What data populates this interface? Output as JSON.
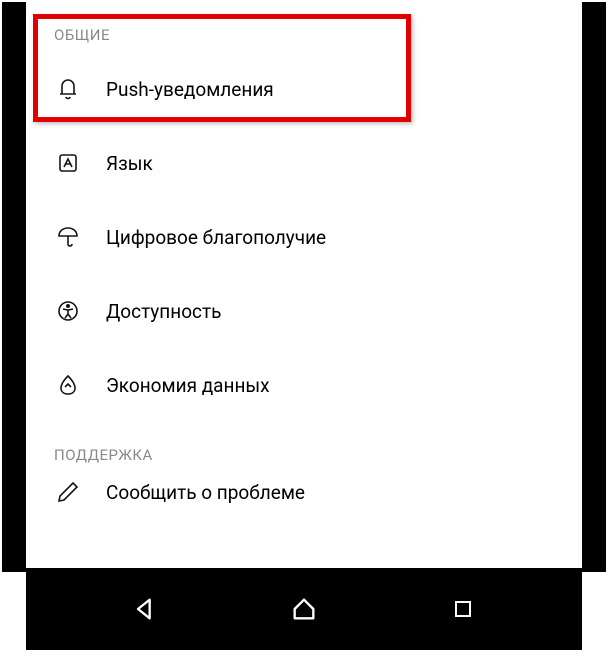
{
  "sections": {
    "general": {
      "header": "ОБЩИЕ",
      "items": [
        {
          "label": "Push-уведомления"
        },
        {
          "label": "Язык"
        },
        {
          "label": "Цифровое благополучие"
        },
        {
          "label": "Доступность"
        },
        {
          "label": "Экономия данных"
        }
      ]
    },
    "support": {
      "header": "ПОДДЕРЖКА",
      "items": [
        {
          "label": "Сообщить о проблеме"
        }
      ]
    }
  }
}
